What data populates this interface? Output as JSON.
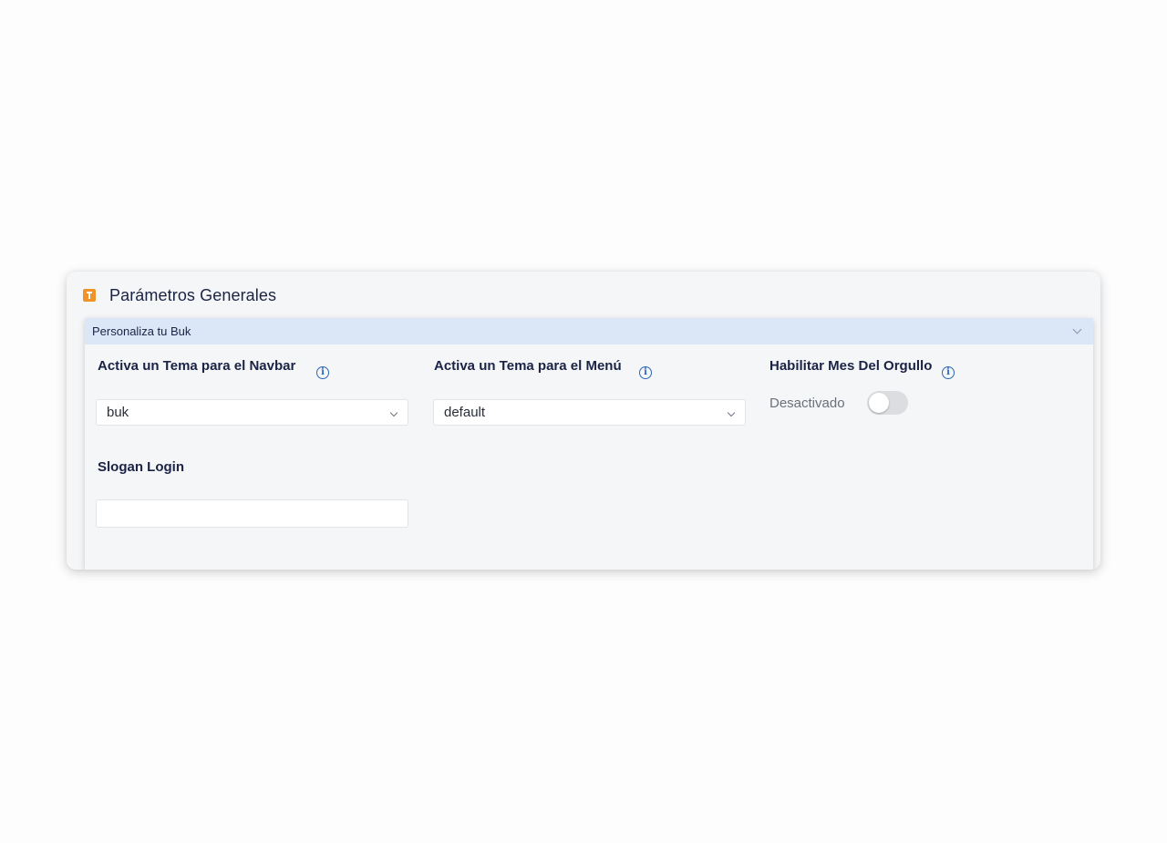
{
  "card": {
    "title": "Parámetros Generales",
    "icon": "info-badge-icon"
  },
  "section": {
    "label": "Personaliza tu Buk",
    "expanded": true
  },
  "fields": {
    "navbar_theme": {
      "label": "Activa un Tema para el Navbar",
      "value": "buk"
    },
    "menu_theme": {
      "label": "Activa un Tema para el Menú",
      "value": "default"
    },
    "pride_month": {
      "label": "Habilitar Mes Del Orgullo",
      "status_text": "Desactivado",
      "enabled": false
    },
    "slogan_login": {
      "label": "Slogan Login",
      "value": "",
      "placeholder": ""
    }
  },
  "colors": {
    "accent_orange": "#f0942a",
    "info_blue": "#2d64b8",
    "section_bar": "#dbe6f7",
    "title_navy": "#1b2345"
  }
}
